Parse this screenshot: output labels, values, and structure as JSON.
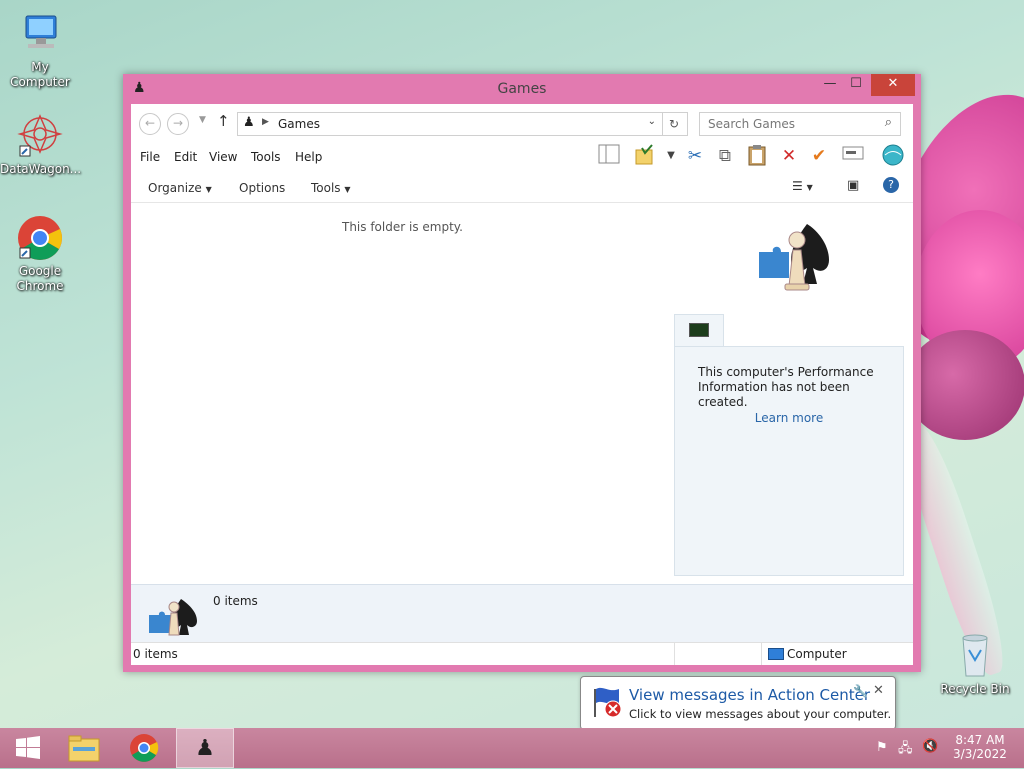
{
  "desktop": {
    "icons": [
      {
        "label": "My Computer"
      },
      {
        "label": "DataWagon..."
      },
      {
        "label": "Google Chrome"
      },
      {
        "label": "Recycle Bin"
      }
    ]
  },
  "window": {
    "title": "Games",
    "controls": {
      "minimize": "—",
      "maximize": "☐",
      "close": "✕"
    },
    "address": {
      "path": "Games"
    },
    "search": {
      "placeholder": "Search Games"
    },
    "menu": [
      "File",
      "Edit",
      "View",
      "Tools",
      "Help"
    ],
    "commands": {
      "organize": "Organize",
      "options": "Options",
      "tools": "Tools"
    },
    "content": {
      "empty_message": "This folder is empty."
    },
    "performance_panel": {
      "message": "This computer's Performance Information has not been created.",
      "link": "Learn more"
    },
    "details_pane": {
      "count": "0 items"
    },
    "status_bar": {
      "items": "0 items",
      "location": "Computer"
    }
  },
  "notification": {
    "title": "View messages in Action Center",
    "subtitle": "Click to view messages about your computer."
  },
  "taskbar": {
    "time": "8:47 AM",
    "date": "3/3/2022"
  },
  "colors": {
    "window_frame": "#e27ab0",
    "close_button": "#c9443a",
    "taskbar": "#c27c96",
    "link": "#2a66a8"
  }
}
